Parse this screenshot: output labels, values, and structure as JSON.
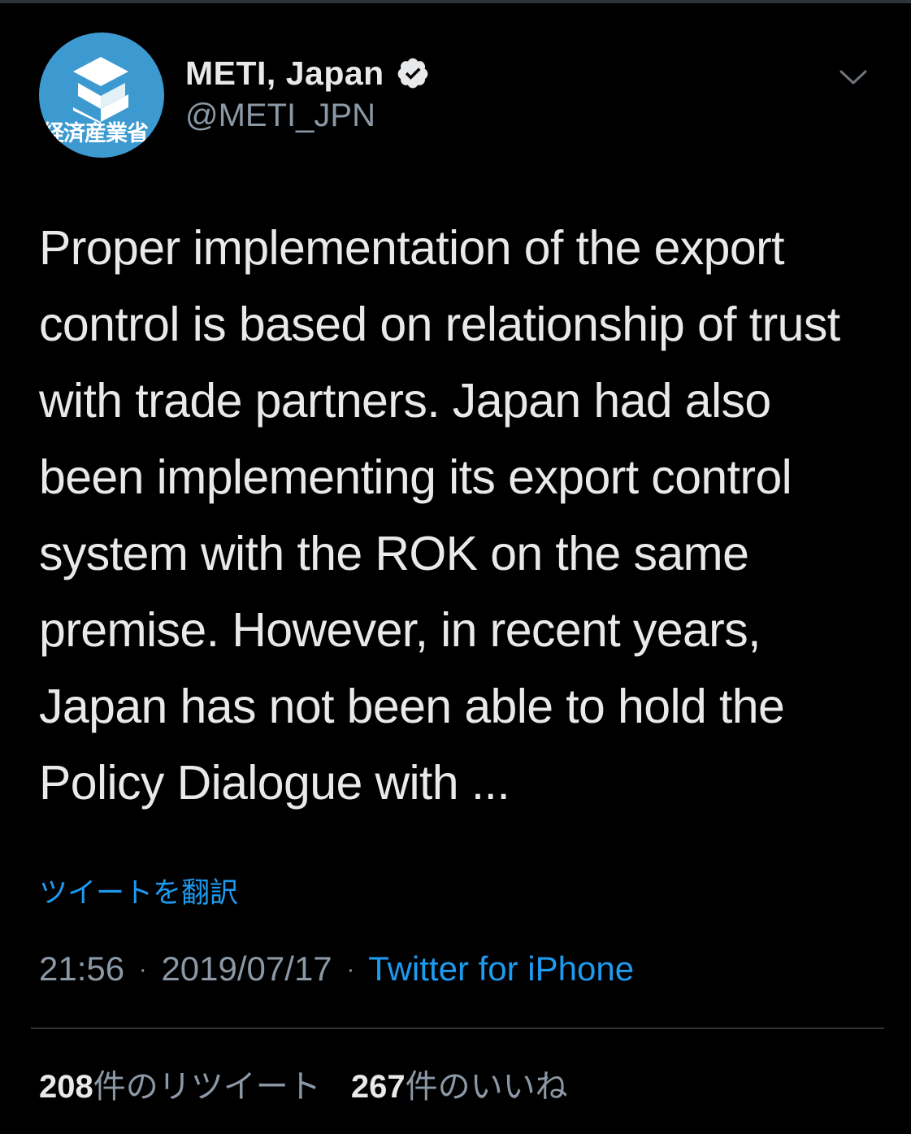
{
  "tweet": {
    "author": {
      "display_name": "METI, Japan",
      "handle": "@METI_JPN",
      "avatar_text": "経済産業省",
      "verified": true,
      "avatar_color": "#3d9ad1"
    },
    "text": "Proper implementation of the export\ncontrol is based on relationship of trust\nwith trade partners. Japan had also\nbeen implementing its export control\nsystem with the ROK on the same\npremise. However, in recent years,\nJapan has not been able to hold the\nPolicy Dialogue with ...",
    "translate_label": "ツイートを翻訳",
    "time": "21:56",
    "date": "2019/07/17",
    "separator": "·",
    "source": "Twitter for iPhone",
    "retweets": {
      "count": "208",
      "label": "件のリツイート"
    },
    "likes": {
      "count": "267",
      "label": "件のいいね"
    }
  },
  "icons": {
    "verified": "verified-badge-icon",
    "menu": "chevron-down-icon",
    "avatar_logo": "meti-logo-icon"
  },
  "colors": {
    "background": "#000000",
    "text": "#e7e9ea",
    "secondary": "#8b98a5",
    "link": "#1d9bf0"
  }
}
